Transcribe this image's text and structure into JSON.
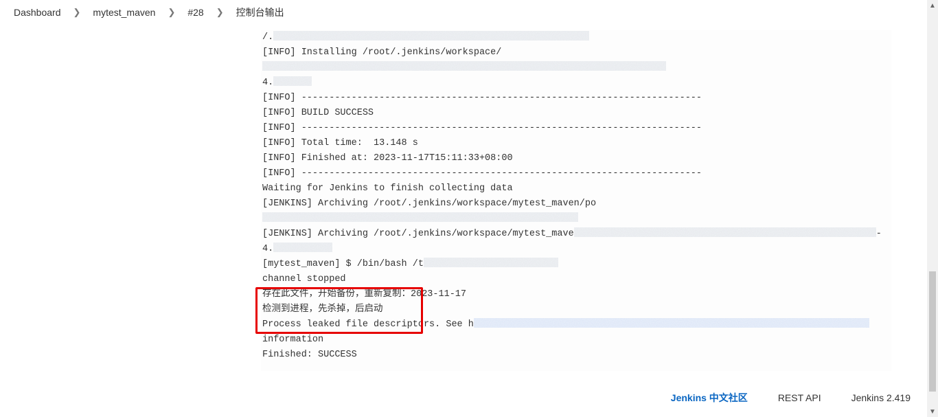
{
  "breadcrumb": {
    "items": [
      "Dashboard",
      "mytest_maven",
      "#28",
      "控制台输出"
    ]
  },
  "console": {
    "lines": [
      "/.",
      "[INFO] Installing /root/.jenkins/workspace/",
      "4.",
      "[INFO] ------------------------------------------------------------------------",
      "[INFO] BUILD SUCCESS",
      "[INFO] ------------------------------------------------------------------------",
      "[INFO] Total time:  13.148 s",
      "[INFO] Finished at: 2023-11-17T15:11:33+08:00",
      "[INFO] ------------------------------------------------------------------------",
      "Waiting for Jenkins to finish collecting data",
      "[JENKINS] Archiving /root/.jenkins/workspace/mytest_maven/po",
      "[JENKINS] Archiving /root/.jenkins/workspace/mytest_mave",
      "4.",
      "[mytest_maven] $ /bin/bash /t",
      "channel stopped",
      "存在此文件，开始备份，重新复制：2023-11-17",
      "检测到进程，先杀掉，后启动",
      "Process leaked file descriptors. See h",
      "information",
      "Finished: SUCCESS"
    ]
  },
  "footer": {
    "community": "Jenkins 中文社区",
    "restapi": "REST API",
    "version": "Jenkins 2.419"
  }
}
